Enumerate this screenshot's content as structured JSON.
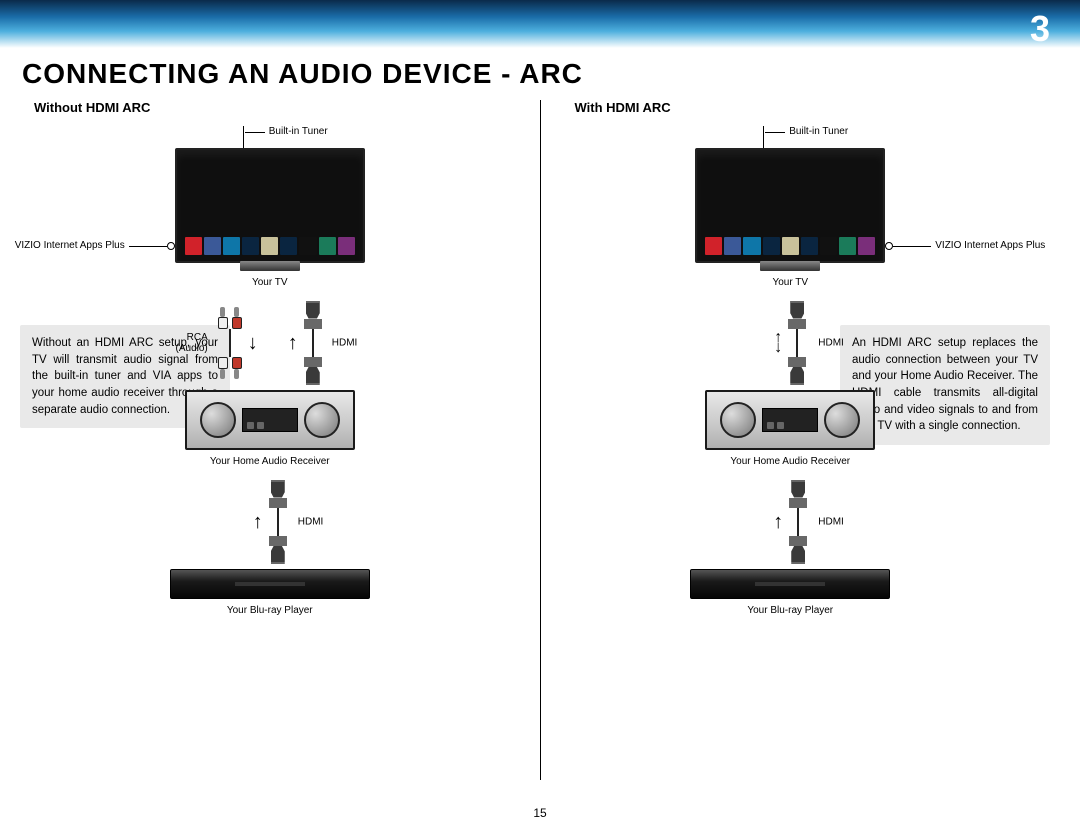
{
  "page_number_corner": "3",
  "page_number_footer": "15",
  "title": "CONNECTING AN AUDIO DEVICE - ARC",
  "left": {
    "heading": "Without HDMI ARC",
    "tuner_label": "Built-in Tuner",
    "apps_label": "VIZIO Internet  Apps Plus",
    "tv_label": "Your TV",
    "rca_label": "RCA (Audio)",
    "hdmi1_label": "HDMI",
    "receiver_label": "Your Home Audio Receiver",
    "hdmi2_label": "HDMI",
    "bluray_label": "Your Blu-ray Player",
    "box_text": "Without an HDMI ARC setup, your TV will transmit audio signal from the built-in tuner and VIA apps to your home audio receiver through a separate audio connection."
  },
  "right": {
    "heading": "With HDMI ARC",
    "tuner_label": "Built-in Tuner",
    "apps_label": "VIZIO Internet  Apps Plus",
    "tv_label": "Your TV",
    "hdmi1_label": "HDMI",
    "receiver_label": "Your Home Audio Receiver",
    "hdmi2_label": "HDMI",
    "bluray_label": "Your Blu-ray Player",
    "box_text": "An HDMI ARC setup replaces the audio connection between your TV and your Home Audio Receiver. The HDMI cable transmits all-digital audio and video signals to and from your TV with a single  connection."
  }
}
